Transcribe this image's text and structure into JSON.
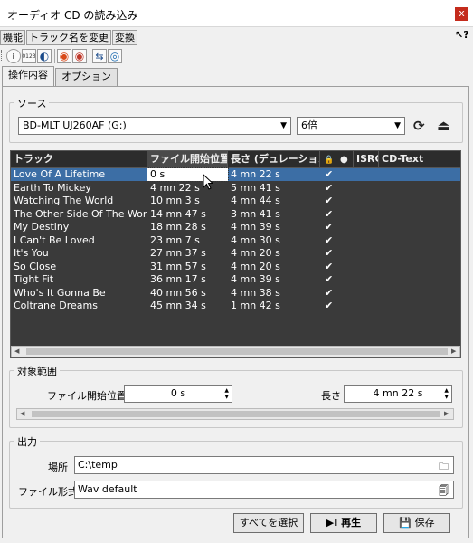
{
  "window": {
    "title": "オーディオ CD の読み込み",
    "close_glyph": "x"
  },
  "menu": [
    {
      "label": "機能"
    },
    {
      "label": "トラック名を変更"
    },
    {
      "label": "変換"
    }
  ],
  "help_glyph": "↖?",
  "toolbar": {
    "buttons": [
      {
        "name": "info-icon",
        "glyph": "i"
      },
      {
        "name": "numbers-icon",
        "glyph": "0123"
      },
      {
        "name": "cd-eject-icon",
        "glyph": "◐"
      },
      {
        "name": "cd-read-icon",
        "glyph": "◉"
      },
      {
        "name": "cd-write-icon",
        "glyph": "◉"
      },
      {
        "name": "transfer-icon",
        "glyph": "⇆"
      },
      {
        "name": "disc-icon",
        "glyph": "◎"
      }
    ]
  },
  "tabs": [
    {
      "label": "操作内容",
      "active": true
    },
    {
      "label": "オプション",
      "active": false
    }
  ],
  "source": {
    "group_label": "ソース",
    "drive": "BD-MLT UJ260AF (G:)",
    "speed": "6倍",
    "refresh_glyph": "⟳",
    "eject_glyph": "⏏"
  },
  "table": {
    "columns": [
      "トラック",
      "ファイル開始位置",
      "長さ (デュレーション)",
      "🔒",
      "●",
      "ISRC",
      "CD-Text"
    ],
    "tracks": [
      {
        "name": "Love Of A Lifetime",
        "start": "0 s",
        "length": "4 mn 22 s",
        "checked": true
      },
      {
        "name": "Earth To Mickey",
        "start": "4 mn 22 s",
        "length": "5 mn 41 s",
        "checked": true
      },
      {
        "name": "Watching The World",
        "start": "10 mn 3 s",
        "length": "4 mn 44 s",
        "checked": true
      },
      {
        "name": "The Other Side Of The World",
        "start": "14 mn 47 s",
        "length": "3 mn 41 s",
        "checked": true
      },
      {
        "name": "My Destiny",
        "start": "18 mn 28 s",
        "length": "4 mn 39 s",
        "checked": true
      },
      {
        "name": "I Can't Be Loved",
        "start": "23 mn 7 s",
        "length": "4 mn 30 s",
        "checked": true
      },
      {
        "name": "It's You",
        "start": "27 mn 37 s",
        "length": "4 mn 20 s",
        "checked": true
      },
      {
        "name": "So Close",
        "start": "31 mn 57 s",
        "length": "4 mn 20 s",
        "checked": true
      },
      {
        "name": "Tight Fit",
        "start": "36 mn 17 s",
        "length": "4 mn 39 s",
        "checked": true
      },
      {
        "name": "Who's It Gonna Be",
        "start": "40 mn 56 s",
        "length": "4 mn 38 s",
        "checked": true
      },
      {
        "name": "Coltrane Dreams",
        "start": "45 mn 34 s",
        "length": "1 mn 42 s",
        "checked": true
      }
    ],
    "check_glyph": "✔"
  },
  "range": {
    "group_label": "対象範囲",
    "start_label": "ファイル開始位置",
    "start_value": "0 s",
    "length_label": "長さ",
    "length_value": "4 mn 22 s"
  },
  "output": {
    "group_label": "出力",
    "location_label": "場所",
    "location_value": "C:\\temp",
    "format_label": "ファイル形式",
    "format_value": "Wav default"
  },
  "buttons": {
    "select_all": "すべてを選択",
    "play": "▶I 再生",
    "save": "保存"
  },
  "colors": {
    "selection": "#3c6ea5",
    "table_bg": "#3a3a3a",
    "close": "#c42b1c"
  }
}
